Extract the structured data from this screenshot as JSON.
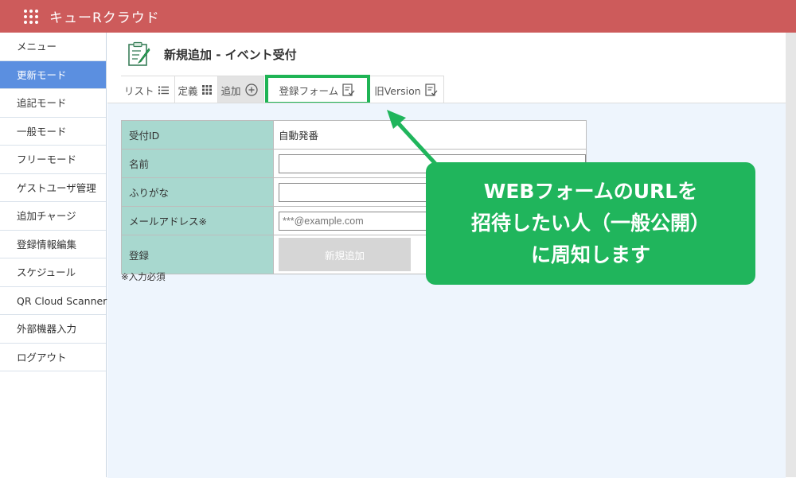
{
  "app": {
    "title": "キューRクラウド"
  },
  "sidebar": {
    "items": [
      {
        "label": "メニュー",
        "active": false
      },
      {
        "label": "更新モード",
        "active": true
      },
      {
        "label": "追記モード",
        "active": false
      },
      {
        "label": "一般モード",
        "active": false
      },
      {
        "label": "フリーモード",
        "active": false
      },
      {
        "label": "ゲストユーザ管理",
        "active": false
      },
      {
        "label": "追加チャージ",
        "active": false
      },
      {
        "label": "登録情報編集",
        "active": false
      },
      {
        "label": "スケジュール",
        "active": false
      },
      {
        "label": "QR Cloud Scanner",
        "active": false
      },
      {
        "label": "外部機器入力",
        "active": false
      },
      {
        "label": "ログアウト",
        "active": false
      }
    ]
  },
  "page": {
    "title": "新規追加 - イベント受付"
  },
  "tabs": [
    {
      "label": "リスト",
      "icon": "list-icon"
    },
    {
      "label": "定義",
      "icon": "grid-dots-icon"
    },
    {
      "label": "追加",
      "icon": "plus-circle-icon"
    },
    {
      "label": "登録フォーム",
      "icon": "form-check-icon"
    },
    {
      "label": "旧Version",
      "icon": "form-check-icon"
    }
  ],
  "form": {
    "rows": [
      {
        "label": "受付ID",
        "value": "自動発番"
      },
      {
        "label": "名前",
        "placeholder": ""
      },
      {
        "label": "ふりがな",
        "placeholder": ""
      },
      {
        "label": "メールアドレス※",
        "placeholder": "***@example.com"
      },
      {
        "label": "登録",
        "button": "新規追加"
      }
    ],
    "note": "※入力必須"
  },
  "callout": {
    "lines": [
      "WEBフォームのURLを",
      "招待したい人（一般公開）",
      "に周知します"
    ]
  },
  "colors": {
    "topbar": "#cd5b5b",
    "active": "#5b8fe0",
    "highlight": "#1fb455",
    "label_bg": "#a8d8cf"
  }
}
